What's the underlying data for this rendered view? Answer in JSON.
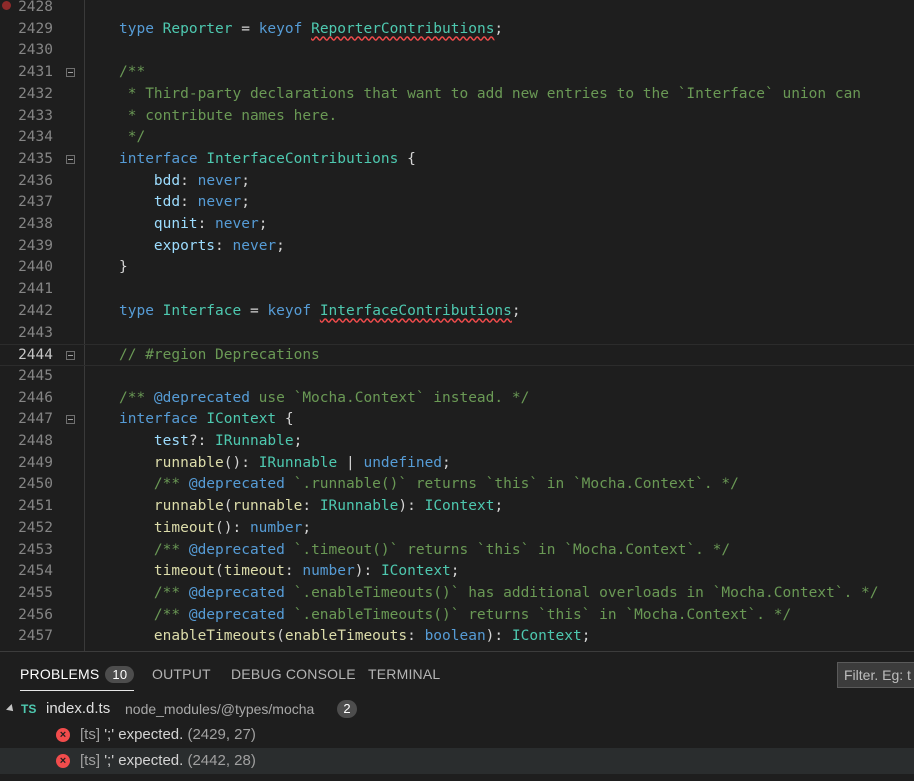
{
  "editor": {
    "lines": [
      {
        "n": "2428",
        "text": "",
        "breakpoint": true
      },
      {
        "n": "2429",
        "text": "type Reporter = keyof ReporterContributions;"
      },
      {
        "n": "2430",
        "text": ""
      },
      {
        "n": "2431",
        "text": "/**",
        "fold": true
      },
      {
        "n": "2432",
        "text": " * Third-party declarations that want to add new entries to the `Interface` union can"
      },
      {
        "n": "2433",
        "text": " * contribute names here."
      },
      {
        "n": "2434",
        "text": " */"
      },
      {
        "n": "2435",
        "text": "interface InterfaceContributions {",
        "fold": true
      },
      {
        "n": "2436",
        "text": "    bdd: never;"
      },
      {
        "n": "2437",
        "text": "    tdd: never;"
      },
      {
        "n": "2438",
        "text": "    qunit: never;"
      },
      {
        "n": "2439",
        "text": "    exports: never;"
      },
      {
        "n": "2440",
        "text": "}"
      },
      {
        "n": "2441",
        "text": ""
      },
      {
        "n": "2442",
        "text": "type Interface = keyof InterfaceContributions;"
      },
      {
        "n": "2443",
        "text": ""
      },
      {
        "n": "2444",
        "text": "// #region Deprecations",
        "fold": true,
        "current": true
      },
      {
        "n": "2445",
        "text": ""
      },
      {
        "n": "2446",
        "text": "/** @deprecated use `Mocha.Context` instead. */"
      },
      {
        "n": "2447",
        "text": "interface IContext {",
        "fold": true
      },
      {
        "n": "2448",
        "text": "    test?: IRunnable;"
      },
      {
        "n": "2449",
        "text": "    runnable(): IRunnable | undefined;"
      },
      {
        "n": "2450",
        "text": "    /** @deprecated `.runnable()` returns `this` in `Mocha.Context`. */"
      },
      {
        "n": "2451",
        "text": "    runnable(runnable: IRunnable): IContext;"
      },
      {
        "n": "2452",
        "text": "    timeout(): number;"
      },
      {
        "n": "2453",
        "text": "    /** @deprecated `.timeout()` returns `this` in `Mocha.Context`. */"
      },
      {
        "n": "2454",
        "text": "    timeout(timeout: number): IContext;"
      },
      {
        "n": "2455",
        "text": "    /** @deprecated `.enableTimeouts()` has additional overloads in `Mocha.Context`. */"
      },
      {
        "n": "2456",
        "text": "    /** @deprecated `.enableTimeouts()` returns `this` in `Mocha.Context`. */"
      },
      {
        "n": "2457",
        "text": "    enableTimeouts(enableTimeouts: boolean): IContext;"
      }
    ]
  },
  "panel": {
    "tabs": [
      {
        "label": "PROBLEMS",
        "badge": "10",
        "active": true
      },
      {
        "label": "OUTPUT"
      },
      {
        "label": "DEBUG CONSOLE"
      },
      {
        "label": "TERMINAL"
      }
    ],
    "filter_placeholder": "Filter. Eg: t",
    "file": {
      "icon": "TS",
      "name": "index.d.ts",
      "path": "node_modules/@types/mocha",
      "count": "2"
    },
    "problems": [
      {
        "source": "[ts]",
        "message": "';' expected.",
        "location": "(2429, 27)"
      },
      {
        "source": "[ts]",
        "message": "';' expected.",
        "location": "(2442, 28)"
      }
    ]
  },
  "colors": {
    "background": "#1e1e1e",
    "keyword": "#569cd6",
    "type": "#4ec9b0",
    "comment": "#6a9955",
    "error": "#f14c4c"
  }
}
